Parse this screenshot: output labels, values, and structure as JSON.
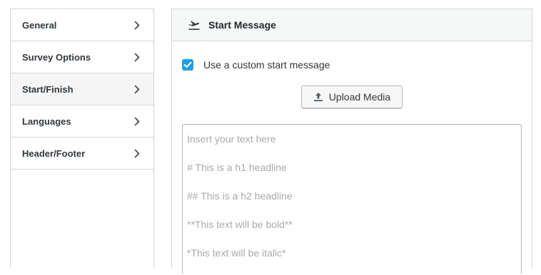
{
  "sidebar": {
    "items": [
      {
        "label": "General",
        "active": false
      },
      {
        "label": "Survey Options",
        "active": false
      },
      {
        "label": "Start/Finish",
        "active": true
      },
      {
        "label": "Languages",
        "active": false
      },
      {
        "label": "Header/Footer",
        "active": false
      }
    ]
  },
  "panel": {
    "title": "Start Message",
    "title_icon": "plane-takeoff-icon",
    "checkbox": {
      "label": "Use a custom start message",
      "checked": true
    },
    "upload_button": {
      "label": "Upload Media",
      "icon": "upload-icon"
    },
    "editor": {
      "placeholder_lines": [
        "Insert your text here",
        "# This is a h1 headline",
        "## This is a h2 headline",
        "**This text will be bold**",
        "*This text will be italic*"
      ]
    }
  },
  "colors": {
    "accent": "#1e9ee8",
    "active_bg": "#f5f5f5",
    "border": "#d5d5d5",
    "placeholder": "#a7aaad"
  }
}
